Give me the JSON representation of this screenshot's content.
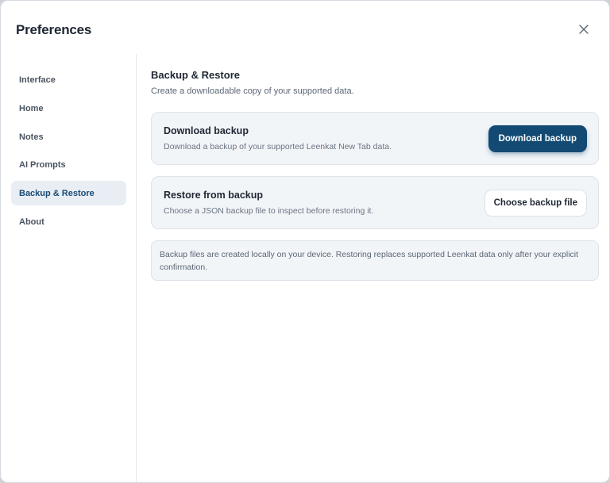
{
  "dialog": {
    "title": "Preferences",
    "close_icon": "close-icon"
  },
  "sidebar": {
    "items": [
      {
        "label": "Interface",
        "active": false
      },
      {
        "label": "Home",
        "active": false
      },
      {
        "label": "Notes",
        "active": false
      },
      {
        "label": "AI Prompts",
        "active": false
      },
      {
        "label": "Backup & Restore",
        "active": true
      },
      {
        "label": "About",
        "active": false
      }
    ]
  },
  "main": {
    "title": "Backup & Restore",
    "subtitle": "Create a downloadable copy of your supported data.",
    "download_card": {
      "title": "Download backup",
      "description": "Download a backup of your supported Leenkat New Tab data.",
      "button_label": "Download backup"
    },
    "restore_card": {
      "title": "Restore from backup",
      "description": "Choose a JSON backup file to inspect before restoring it.",
      "button_label": "Choose backup file"
    },
    "note": "Backup files are created locally on your device. Restoring replaces supported Leenkat data only after your explicit confirmation."
  },
  "colors": {
    "accent": "#124a73",
    "active_nav_bg": "#e8eef4",
    "card_bg": "#f2f5f8"
  }
}
